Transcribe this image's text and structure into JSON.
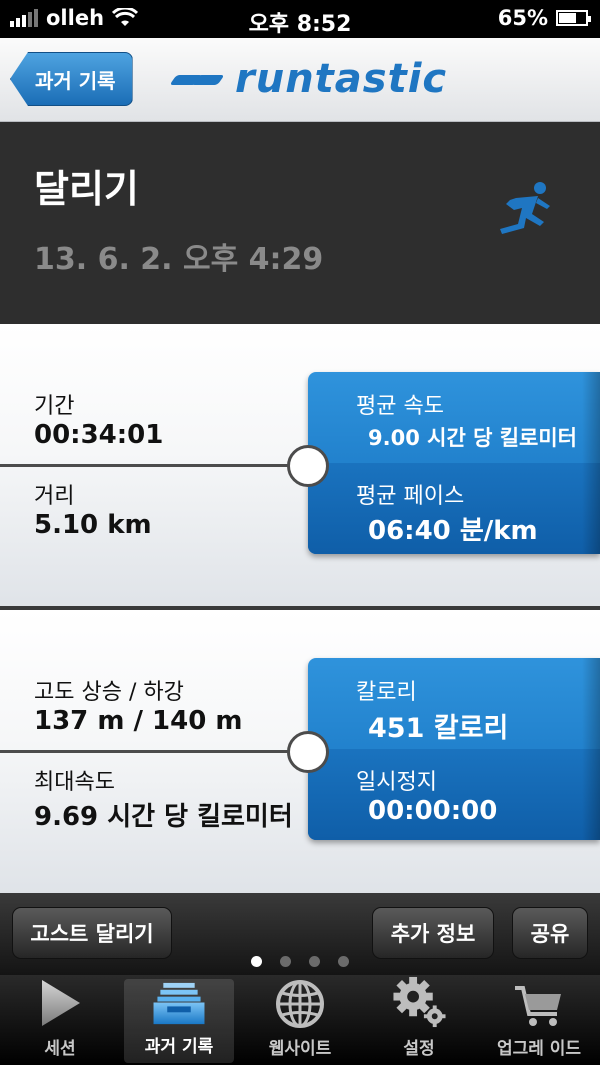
{
  "status_bar": {
    "carrier": "olleh",
    "time": "오후 8:52",
    "battery": "65%",
    "battery_level": 0.65
  },
  "nav": {
    "back_label": "과거 기록",
    "logo_text": "runtastic"
  },
  "header": {
    "title": "달리기",
    "date": "13. 6. 2. 오후 4:29",
    "icon": "runner-icon"
  },
  "panel1": {
    "left_top_label": "기간",
    "left_top_value": "00:34:01",
    "left_bottom_label": "거리",
    "left_bottom_value": "5.10 km",
    "right_top_label": "평균 속도",
    "right_top_value": "9.00 시간 당 킬로미터",
    "right_bottom_label": "평균 페이스",
    "right_bottom_value": "06:40 분/km"
  },
  "panel2": {
    "left_top_label": "고도 상승 / 하강",
    "left_top_value": "137 m / 140 m",
    "left_bottom_label": "최대속도",
    "left_bottom_value": "9.69 시간 당 킬로미터",
    "right_top_label": "칼로리",
    "right_top_value": "451 칼로리",
    "right_bottom_label": "일시정지",
    "right_bottom_value": "00:00:00"
  },
  "actions": {
    "ghost_run": "고스트 달리기",
    "more_info": "추가 정보",
    "share": "공유"
  },
  "pager": {
    "count": 4,
    "active_index": 0
  },
  "tabs": [
    {
      "label": "세션",
      "icon": "play-icon"
    },
    {
      "label": "과거 기록",
      "icon": "history-tray-icon",
      "active": true
    },
    {
      "label": "웹사이트",
      "icon": "globe-icon"
    },
    {
      "label": "설정",
      "icon": "gear-icon"
    },
    {
      "label": "업그레 이드",
      "icon": "cart-icon"
    }
  ],
  "colors": {
    "brand_blue": "#1f76c2",
    "card_blue": "#1a78c6",
    "header_bg": "#2e2e2e"
  }
}
